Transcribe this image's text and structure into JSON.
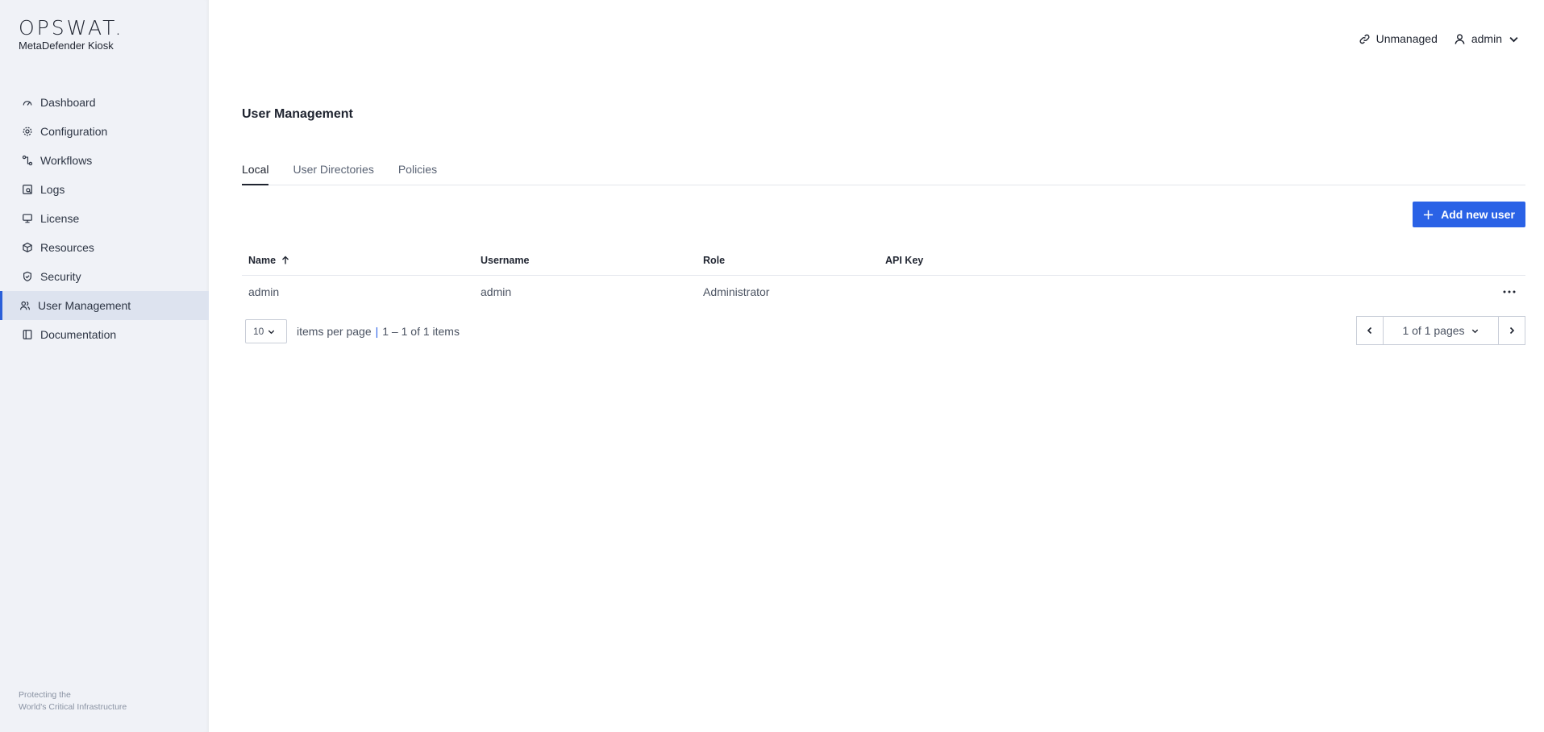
{
  "brand": {
    "logo": "OPSWAT.",
    "product": "MetaDefender Kiosk",
    "footer_line1": "Protecting the",
    "footer_line2": "World's Critical Infrastructure"
  },
  "sidebar": {
    "items": [
      {
        "label": "Dashboard",
        "icon": "dashboard-icon"
      },
      {
        "label": "Configuration",
        "icon": "gear-icon"
      },
      {
        "label": "Workflows",
        "icon": "workflow-icon"
      },
      {
        "label": "Logs",
        "icon": "logs-icon"
      },
      {
        "label": "License",
        "icon": "license-icon"
      },
      {
        "label": "Resources",
        "icon": "box-icon"
      },
      {
        "label": "Security",
        "icon": "shield-icon"
      },
      {
        "label": "User Management",
        "icon": "users-icon",
        "active": true
      },
      {
        "label": "Documentation",
        "icon": "book-icon"
      }
    ]
  },
  "header": {
    "unmanaged_label": "Unmanaged",
    "user_label": "admin"
  },
  "page": {
    "title": "User Management",
    "tabs": [
      {
        "label": "Local",
        "active": true
      },
      {
        "label": "User Directories"
      },
      {
        "label": "Policies"
      }
    ],
    "add_button": "Add new user"
  },
  "table": {
    "columns": [
      "Name",
      "Username",
      "Role",
      "API Key"
    ],
    "rows": [
      {
        "name": "admin",
        "username": "admin",
        "role": "Administrator",
        "api_key": ""
      }
    ]
  },
  "pagination": {
    "per_page": "10",
    "per_page_label": "items per page",
    "separator": "|",
    "range": "1 – 1 of 1 items",
    "pages": "1 of 1 pages"
  },
  "colors": {
    "accent": "#2a62e6",
    "sidebar_bg": "#f0f2f7",
    "active_nav_bg": "#dde3ef"
  }
}
